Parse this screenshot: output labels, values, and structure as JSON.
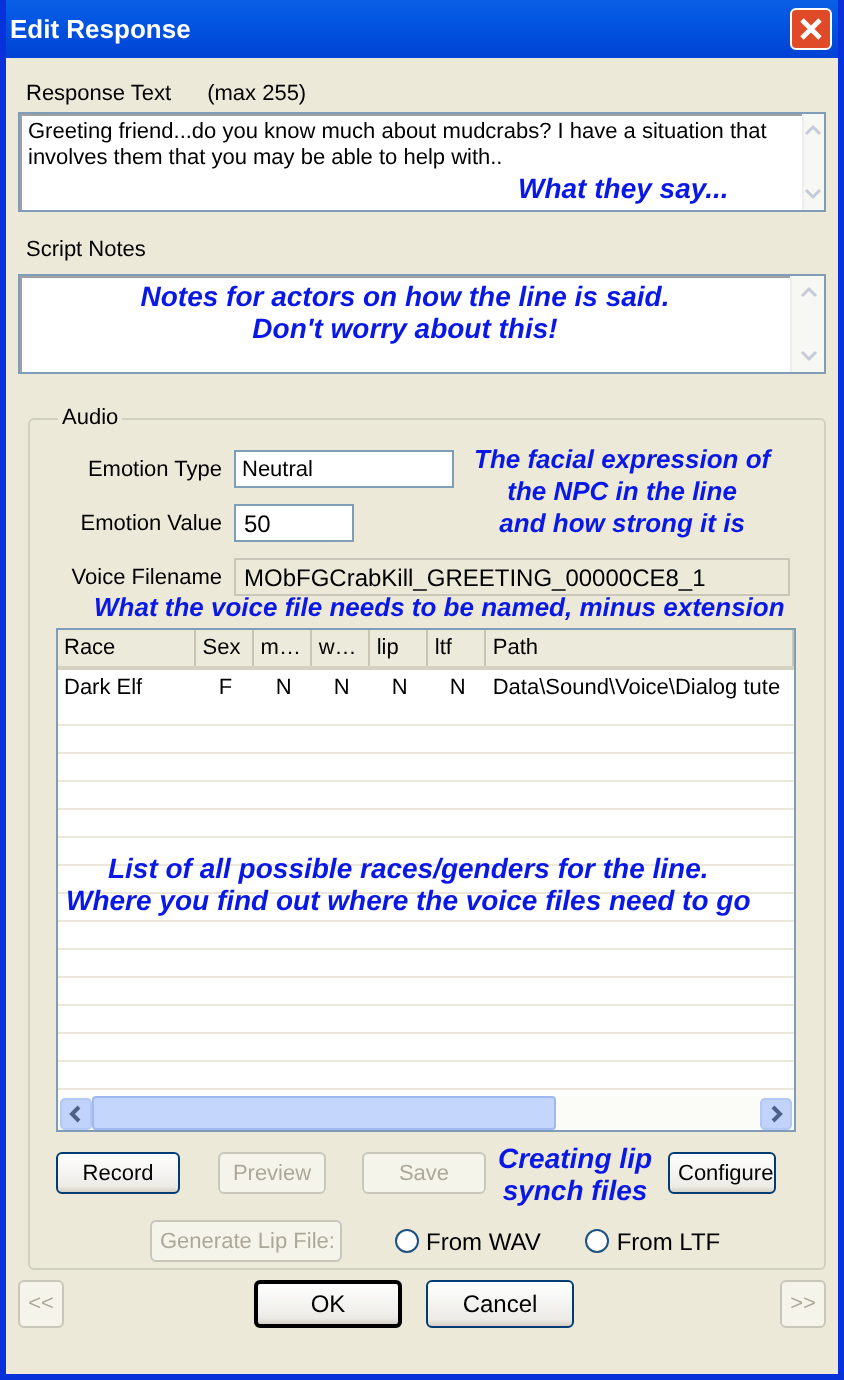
{
  "window": {
    "title": "Edit Response"
  },
  "response_text": {
    "label": "Response Text",
    "limit": "(max 255)",
    "value": "Greeting friend...do you know much about mudcrabs? I have a situation that involves them that you may be able to help with.."
  },
  "script_notes": {
    "label": "Script Notes"
  },
  "audio": {
    "label": "Audio",
    "emotion_type": {
      "label": "Emotion Type",
      "value": "Neutral"
    },
    "emotion_value": {
      "label": "Emotion Value",
      "value": "50"
    },
    "voice_filename": {
      "label": "Voice Filename",
      "value": "MObFGCrabKill_GREETING_00000CE8_1"
    },
    "table": {
      "columns": [
        "Race",
        "Sex",
        "m…",
        "w…",
        "lip",
        "ltf",
        "Path"
      ],
      "rows": [
        [
          "Dark Elf",
          "F",
          "N",
          "N",
          "N",
          "N",
          "Data\\Sound\\Voice\\Dialog tute"
        ]
      ]
    },
    "buttons": [
      {
        "label": "Record",
        "disabled": false
      },
      {
        "label": "Preview",
        "disabled": true
      },
      {
        "label": "Save",
        "disabled": true
      },
      {
        "label": "Configure",
        "disabled": false
      }
    ],
    "generate": {
      "label": "Generate Lip File:",
      "disabled": true
    },
    "radios": [
      {
        "label": "From WAV",
        "selected": false
      },
      {
        "label": "From LTF",
        "selected": false
      }
    ]
  },
  "footer": {
    "prev": {
      "label": "<<",
      "disabled": true
    },
    "buttons": [
      {
        "label": "OK",
        "default": true
      },
      {
        "label": "Cancel",
        "default": false
      }
    ],
    "next": {
      "label": ">>",
      "disabled": true
    }
  },
  "annotations": [
    {
      "text": "What they say..."
    },
    {
      "text": "Notes for actors on how the line is said.\nDon't worry about this!"
    },
    {
      "text": "The facial expression of\nthe NPC in the line\nand how strong it is"
    },
    {
      "text": "What the voice file needs to be named, minus extension"
    },
    {
      "text": "List of all possible races/genders for the line.\nWhere you find out where the voice files need to go"
    },
    {
      "text": "Creating lip\nsynch files"
    }
  ]
}
